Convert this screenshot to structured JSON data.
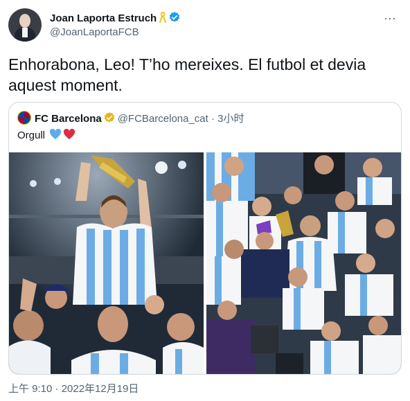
{
  "author": {
    "display_name": "Joan Laporta Estruch",
    "handle": "@JoanLaportaFCB",
    "ribbon_icon": "yellow-ribbon-icon",
    "verified_icon": "blue-verified-badge-icon",
    "verified_color": "#1d9bf0"
  },
  "more_icon": "···",
  "tweet_text": "Enhorabona, Leo! T’ho mereixes. El futbol et devia aquest moment.",
  "quoted_tweet": {
    "display_name": "FC Barcelona",
    "verified_icon": "gold-verified-badge-icon",
    "verified_color": "#e2b719",
    "handle": "@FCBarcelona_cat",
    "separator": "·",
    "time": "3小时",
    "text": "Orgull",
    "hearts": [
      "blue-heart-icon",
      "red-heart-icon"
    ],
    "photos": [
      "messi-holding-trophy-photo",
      "team-celebration-photo"
    ]
  },
  "timestamp": "上午 9:10 · 2022年12月19日"
}
